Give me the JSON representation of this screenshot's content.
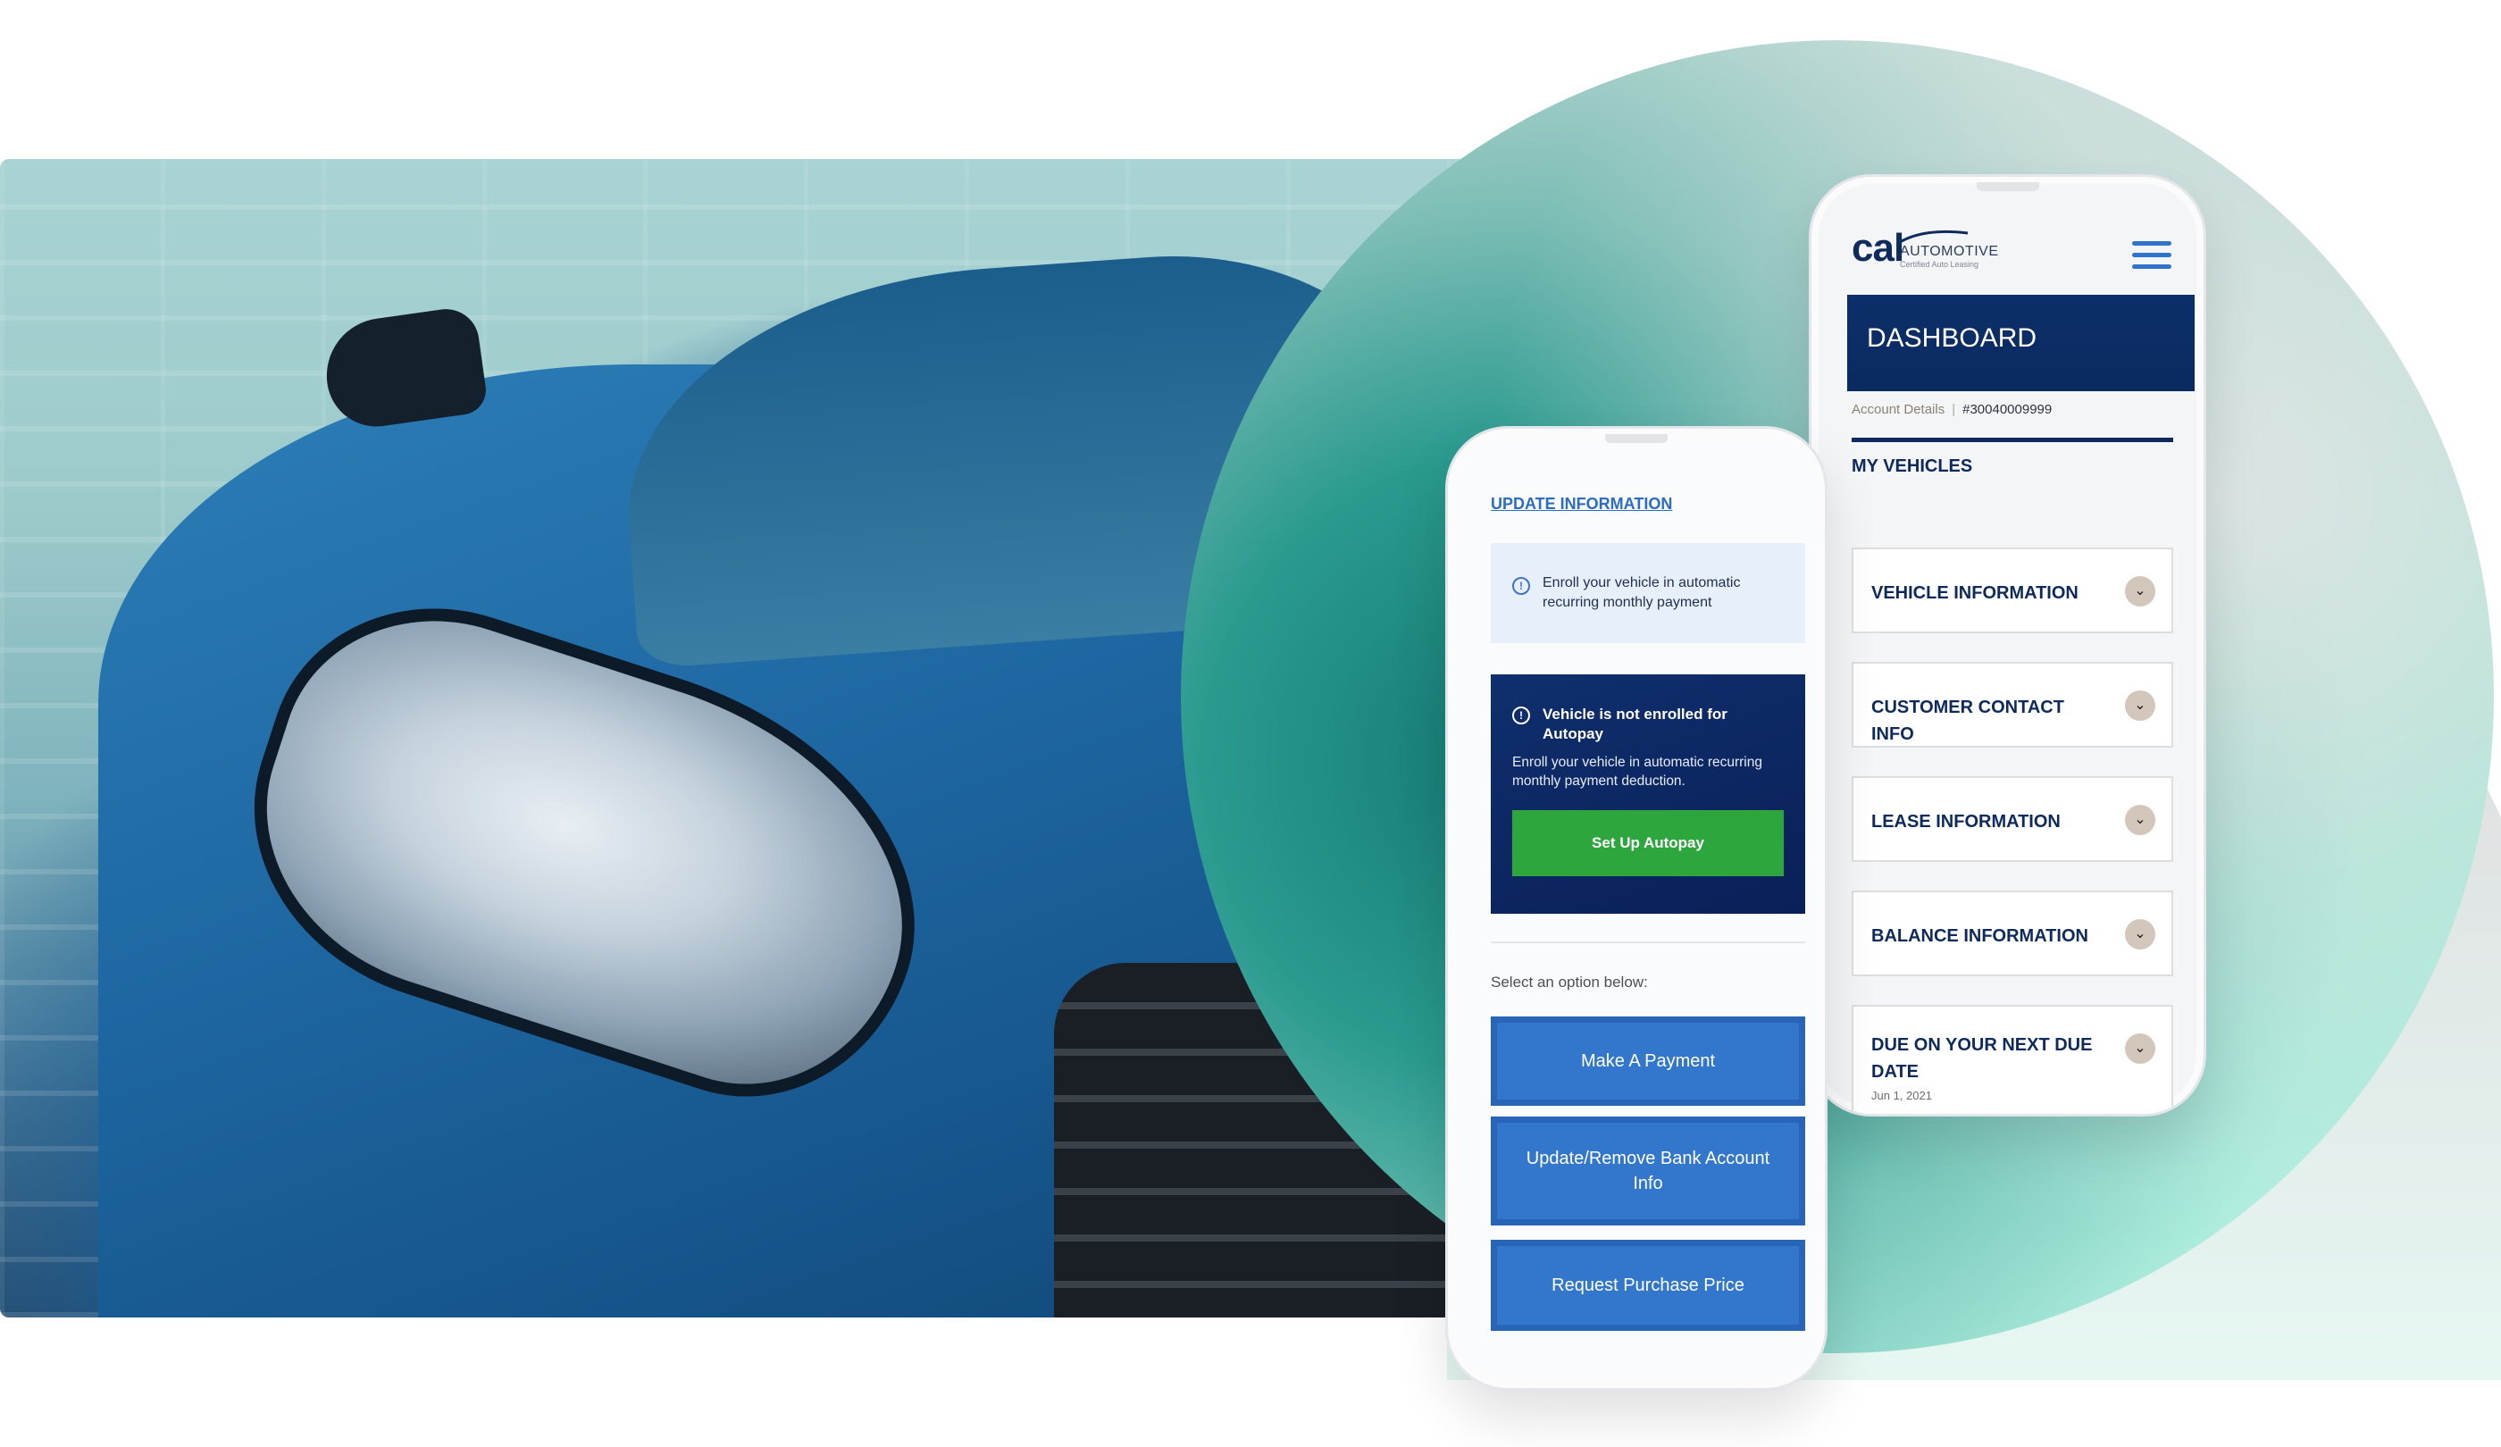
{
  "brand": {
    "logo_word": "cal",
    "logo_sub": "AUTOMOTIVE",
    "logo_tagline": "Certified Auto Leasing",
    "colors": {
      "navy": "#0e2a5c",
      "link_blue": "#2b6cc4",
      "button_blue": "#3277cc",
      "autopay_green": "#2ea63e",
      "teal_accent": "#2a9a8f",
      "chevron_bg": "#d3c7bc"
    }
  },
  "hero_image": {
    "subject": "blue sports car headlight close-up"
  },
  "dashboard_phone": {
    "menu_icon": "hamburger-menu-icon",
    "title": "DASHBOARD",
    "account_label": "Account Details",
    "account_separator": "|",
    "account_number": "#30040009999",
    "section_title": "MY VEHICLES",
    "accordion": [
      {
        "label": "VEHICLE INFORMATION",
        "icon": "chevron-down-icon"
      },
      {
        "label": "CUSTOMER CONTACT INFO",
        "icon": "chevron-down-icon"
      },
      {
        "label": "LEASE INFORMATION",
        "icon": "chevron-down-icon"
      },
      {
        "label": "BALANCE INFORMATION",
        "icon": "chevron-down-icon"
      },
      {
        "label": "DUE ON YOUR NEXT DUE DATE",
        "sub": "Jun 1, 2021",
        "icon": "chevron-down-icon"
      }
    ],
    "chevron_glyph": "⌄"
  },
  "update_phone": {
    "link_label": "UPDATE INFORMATION",
    "info_icon_glyph": "!",
    "info_message": "Enroll your vehicle in automatic recurring monthly payment",
    "autopay_card": {
      "title": "Vehicle is not enrolled for Autopay",
      "body": "Enroll your vehicle in automatic recurring monthly payment deduction.",
      "button_label": "Set Up Autopay"
    },
    "select_prompt": "Select an option below:",
    "options": [
      {
        "label": "Make A Payment"
      },
      {
        "label": "Update/Remove Bank Account Info"
      },
      {
        "label": "Request Purchase Price"
      }
    ]
  }
}
